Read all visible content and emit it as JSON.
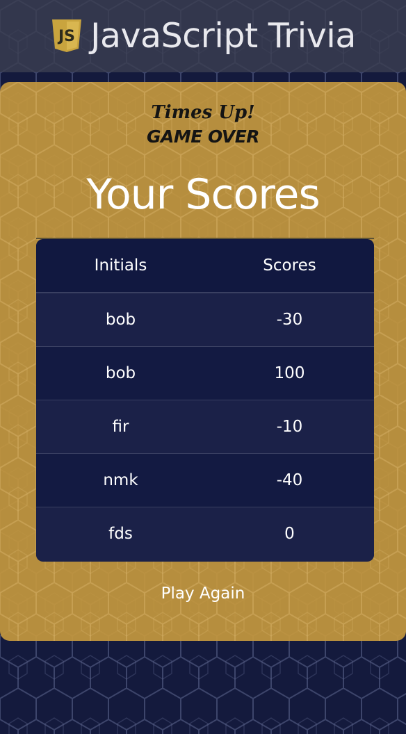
{
  "app": {
    "title": "JavaScript Trivia",
    "logo_text": "JS"
  },
  "result": {
    "times_up": "Times Up!",
    "game_over": "GAME OVER"
  },
  "scores": {
    "title": "Your Scores",
    "columns": [
      "Initials",
      "Scores"
    ],
    "rows": [
      {
        "initials": "bob",
        "score": "-30"
      },
      {
        "initials": "bob",
        "score": "100"
      },
      {
        "initials": "fir",
        "score": "-10"
      },
      {
        "initials": "nmk",
        "score": "-40"
      },
      {
        "initials": "fds",
        "score": "0"
      }
    ]
  },
  "actions": {
    "play_again_label": "Play Again"
  },
  "colors": {
    "card": "#c4983e",
    "table_dark": "#111840",
    "table_light": "#1b2148",
    "logo_yellow": "#c9a43e"
  }
}
